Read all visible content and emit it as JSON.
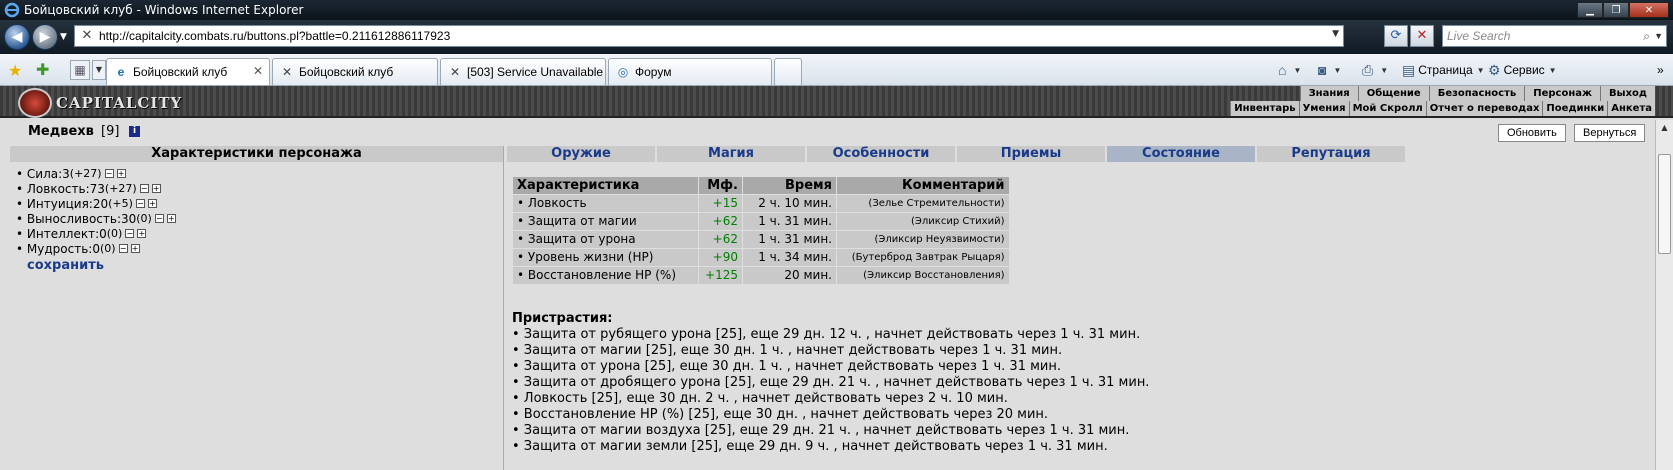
{
  "window": {
    "title": "Бойцовский клуб - Windows Internet Explorer"
  },
  "address": {
    "url": "http://capitalcity.combats.ru/buttons.pl?battle=0.211612886117923",
    "search_placeholder": "Live Search"
  },
  "tabs": [
    {
      "label": "Бойцовский клуб",
      "icon": "ie-icon",
      "active": true
    },
    {
      "label": "Бойцовский клуб",
      "icon": "broken-page-icon",
      "active": false
    },
    {
      "label": "[503] Service Unavailable",
      "icon": "broken-page-icon",
      "active": false
    },
    {
      "label": "Форум",
      "icon": "forum-icon",
      "active": false
    }
  ],
  "commands": {
    "page_label": "Страница",
    "tools_label": "Сервис"
  },
  "game": {
    "logo_text": "CAPITALCITY",
    "menu_top": [
      "Знания",
      "Общение",
      "Безопасность",
      "Персонаж",
      "Выход"
    ],
    "menu_bottom": [
      "Инвентарь",
      "Умения",
      "Мой Скролл",
      "Отчет о переводах",
      "Поединки",
      "Анкета"
    ],
    "character": {
      "name": "Медвехв",
      "level": "[9]"
    },
    "buttons": {
      "refresh": "Обновить",
      "back": "Вернуться"
    },
    "stats_title": "Характеристики персонажа",
    "stats": [
      {
        "label": "Сила: ",
        "value": "3",
        "bonus": "(+27)"
      },
      {
        "label": "Ловкость: ",
        "value": "73",
        "bonus": "(+27)"
      },
      {
        "label": "Интуиция: ",
        "value": "20",
        "bonus": "(+5)"
      },
      {
        "label": "Выносливость: ",
        "value": "30",
        "bonus": "(0)"
      },
      {
        "label": "Интеллект: ",
        "value": "0",
        "bonus": "(0)"
      },
      {
        "label": "Мудрость: ",
        "value": "0",
        "bonus": "(0)"
      }
    ],
    "save_label": "сохранить",
    "section_tabs": [
      "Оружие",
      "Магия",
      "Особенности",
      "Приемы",
      "Состояние",
      "Репутация"
    ],
    "active_section": "Состояние",
    "effects_headers": [
      "Характеристика",
      "Мф.",
      "Время",
      "Комментарий"
    ],
    "effects": [
      {
        "name": "• Ловкость",
        "mf": "+15",
        "time": "2 ч. 10 мин.",
        "comment": "(Зелье Стремительности)"
      },
      {
        "name": "• Защита от магии",
        "mf": "+62",
        "time": "1 ч. 31 мин.",
        "comment": "(Эликсир Стихий)"
      },
      {
        "name": "• Защита от урона",
        "mf": "+62",
        "time": "1 ч. 31 мин.",
        "comment": "(Эликсир Неуязвимости)"
      },
      {
        "name": "• Уровень жизни (HP)",
        "mf": "+90",
        "time": "1 ч. 34 мин.",
        "comment": "(Бутерброд Завтрак Рыцаря)"
      },
      {
        "name": "• Восстановление HP (%)",
        "mf": "+125",
        "time": "20 мин.",
        "comment": "(Эликсир Восстановления)"
      }
    ],
    "addictions_title": "Пристрастия:",
    "addictions": [
      "• Защита от рубящего урона [25], еще 29 дн. 12 ч. , начнет действовать через 1 ч. 31 мин.",
      "• Защита от магии [25], еще 30 дн. 1 ч. , начнет действовать через 1 ч. 31 мин.",
      "• Защита от урона [25], еще 30 дн. 1 ч. , начнет действовать через 1 ч. 31 мин.",
      "• Защита от дробящего урона [25], еще 29 дн. 21 ч. , начнет действовать через 1 ч. 31 мин.",
      "• Ловкость [25], еще 30 дн. 2 ч. , начнет действовать через 2 ч. 10 мин.",
      "• Восстановление HP (%) [25], еще 30 дн. , начнет действовать через 20 мин.",
      "• Защита от магии воздуха [25], еще 29 дн. 21 ч. , начнет действовать через 1 ч. 31 мин.",
      "• Защита от магии земли [25], еще 29 дн. 9 ч. , начнет действовать через 1 ч. 31 мин."
    ]
  }
}
